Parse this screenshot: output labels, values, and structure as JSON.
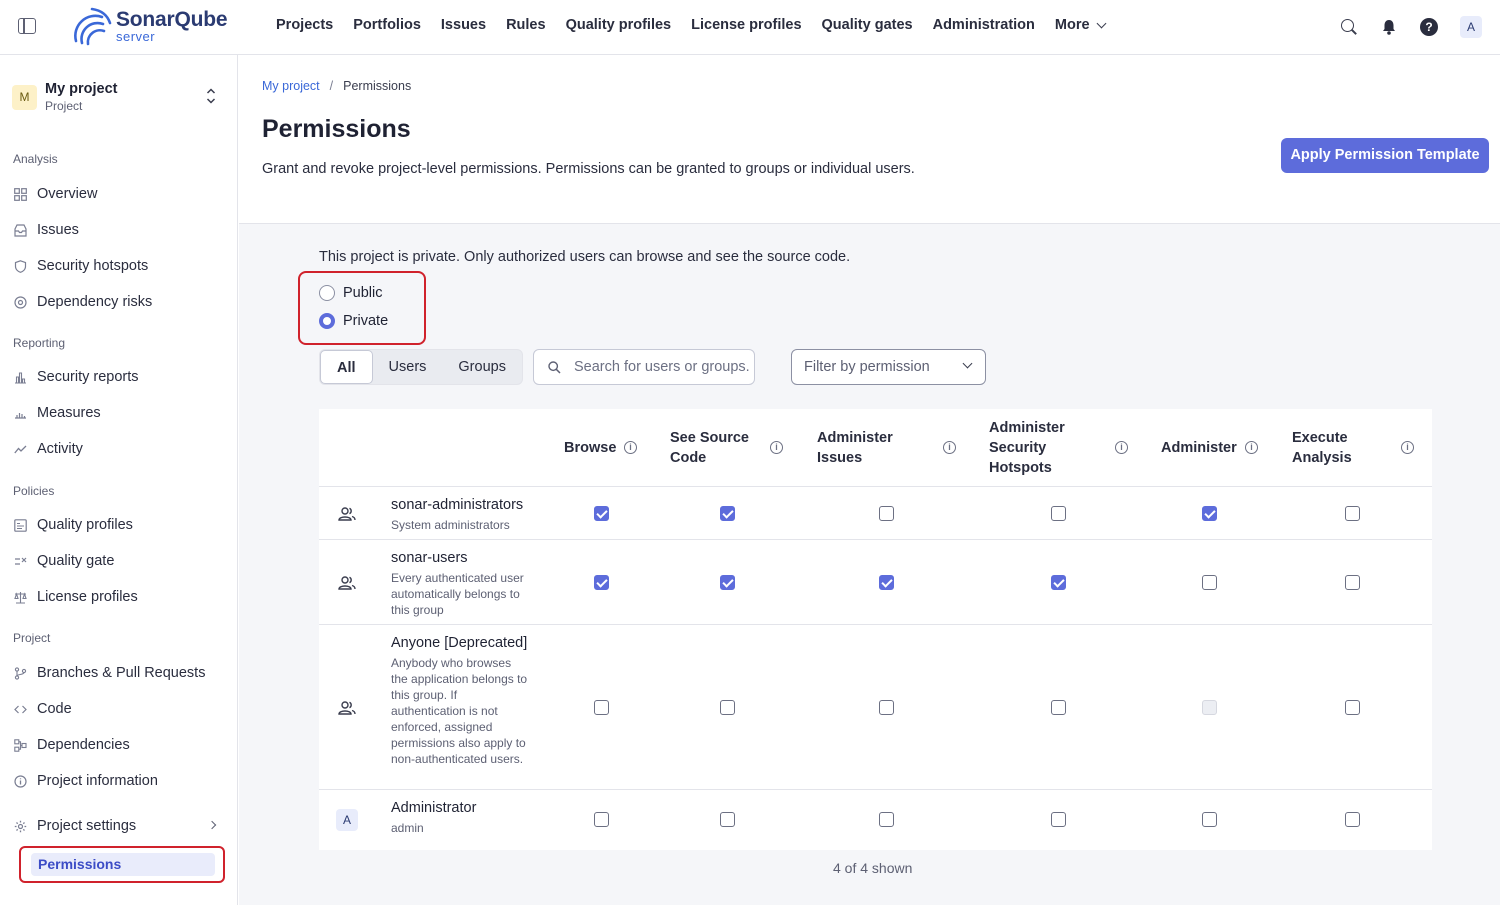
{
  "topnav": {
    "logo_word": "SonarQube",
    "logo_sub": "server",
    "items": [
      "Projects",
      "Portfolios",
      "Issues",
      "Rules",
      "Quality profiles",
      "License profiles",
      "Quality gates",
      "Administration"
    ],
    "more_label": "More",
    "user_initial": "A"
  },
  "sidebar": {
    "project_initial": "M",
    "project_name": "My project",
    "project_type": "Project",
    "sections": {
      "analysis": "Analysis",
      "reporting": "Reporting",
      "policies": "Policies",
      "project": "Project"
    },
    "items": {
      "overview": "Overview",
      "issues": "Issues",
      "security_hotspots": "Security hotspots",
      "dependency_risks": "Dependency risks",
      "security_reports": "Security reports",
      "measures": "Measures",
      "activity": "Activity",
      "quality_profiles": "Quality profiles",
      "quality_gate": "Quality gate",
      "license_profiles": "License profiles",
      "branches": "Branches & Pull Requests",
      "code": "Code",
      "dependencies": "Dependencies",
      "project_information": "Project information",
      "project_settings": "Project settings",
      "permissions": "Permissions"
    }
  },
  "main": {
    "breadcrumb": {
      "project": "My project",
      "current": "Permissions"
    },
    "title": "Permissions",
    "description": "Grant and revoke project-level permissions. Permissions can be granted to groups or individual users.",
    "apply_button": "Apply Permission Template",
    "private_note": "This project is private. Only authorized users can browse and see the source code.",
    "visibility": {
      "public": "Public",
      "private": "Private",
      "selected": "private"
    },
    "tabs": [
      "All",
      "Users",
      "Groups"
    ],
    "active_tab": "All",
    "search_placeholder": "Search for users or groups...",
    "filter_label": "Filter by permission",
    "columns": {
      "browse": "Browse",
      "see_source": "See Source Code",
      "admin_issues": "Administer Issues",
      "admin_hotspots": "Administer Security Hotspots",
      "administer": "Administer",
      "execute": "Execute Analysis"
    },
    "rows": [
      {
        "name": "sonar-administrators",
        "desc": "System administrators",
        "kind": "group",
        "perms": [
          true,
          true,
          false,
          false,
          true,
          false
        ]
      },
      {
        "name": "sonar-users",
        "desc": "Every authenticated user automatically belongs to this group",
        "kind": "group",
        "perms": [
          true,
          true,
          true,
          true,
          false,
          false
        ]
      },
      {
        "name": "Anyone [Deprecated]",
        "desc": "Anybody who browses the application belongs to this group. If authentication is not enforced, assigned permissions also apply to non-authenticated users.",
        "kind": "group",
        "perms": [
          false,
          false,
          false,
          false,
          "disabled",
          false
        ]
      },
      {
        "name": "Administrator",
        "desc": "admin",
        "kind": "user",
        "initial": "A",
        "perms": [
          false,
          false,
          false,
          false,
          false,
          false
        ]
      }
    ],
    "count_text": "4 of 4 shown"
  }
}
